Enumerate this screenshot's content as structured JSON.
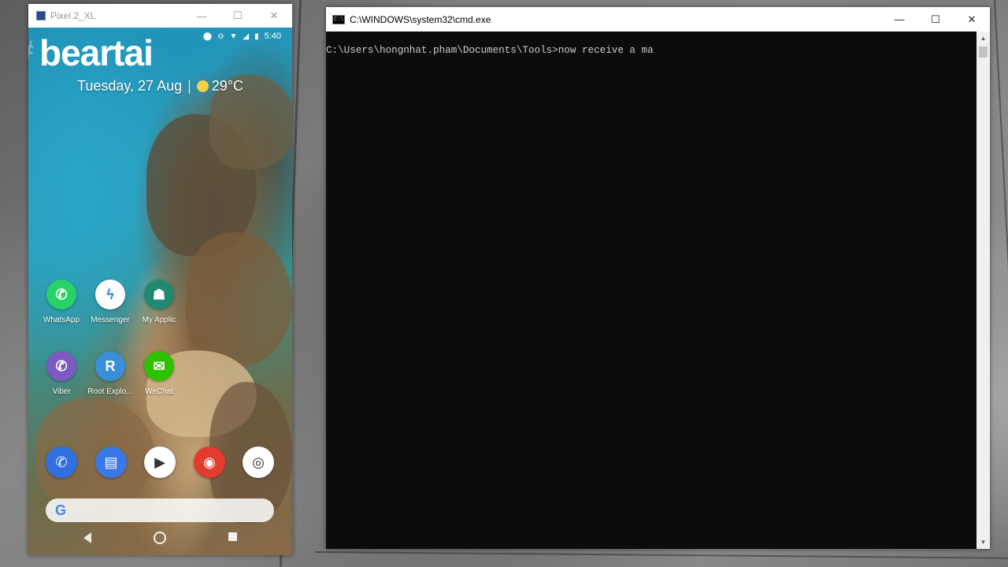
{
  "emulator": {
    "title": "Pixel 2_XL",
    "controls": {
      "minimize": "—",
      "maximize": "☐",
      "close": "✕"
    },
    "status": {
      "time": "5:40"
    },
    "brand": "beartai",
    "brand_hash": "#",
    "date": "Tuesday, 27 Aug",
    "separator": "|",
    "temperature": "29°C",
    "apps_row1": [
      {
        "label": "WhatsApp",
        "icon": "whatsapp-icon",
        "color": "#25d366",
        "glyph": "✆"
      },
      {
        "label": "Messenger",
        "icon": "messenger-icon",
        "color": "#ffffff",
        "glyph": "ϟ"
      },
      {
        "label": "My Applic",
        "icon": "android-icon",
        "color": "#1f8a70",
        "glyph": "☗"
      }
    ],
    "apps_row2": [
      {
        "label": "Viber",
        "icon": "viber-icon",
        "color": "#7d5ac1",
        "glyph": "✆"
      },
      {
        "label": "Root Explo...",
        "icon": "root-explorer-icon",
        "color": "#3a8fd8",
        "glyph": "R"
      },
      {
        "label": "WeChat",
        "icon": "wechat-icon",
        "color": "#2dc100",
        "glyph": "✉"
      }
    ],
    "dock": [
      {
        "icon": "phone-icon",
        "color": "#2f6fe0",
        "glyph": "✆"
      },
      {
        "icon": "messages-icon",
        "color": "#3b78e7",
        "glyph": "▤"
      },
      {
        "icon": "play-store-icon",
        "color": "#ffffff",
        "glyph": "▶"
      },
      {
        "icon": "chrome-icon",
        "color": "#e33b2e",
        "glyph": "◉"
      },
      {
        "icon": "camera-icon",
        "color": "#ffffff",
        "glyph": "◎"
      }
    ],
    "search_glyph": "G"
  },
  "cmd": {
    "title": "C:\\WINDOWS\\system32\\cmd.exe",
    "icon_text": "C:\\",
    "controls": {
      "minimize": "—",
      "maximize": "☐",
      "close": "✕"
    },
    "prompt_line": "C:\\Users\\hongnhat.pham\\Documents\\Tools>now receive a ma",
    "scroll": {
      "up": "▲",
      "down": "▼"
    }
  },
  "colors": {
    "cmd_bg": "#0c0c0c",
    "cmd_fg": "#cccccc"
  }
}
